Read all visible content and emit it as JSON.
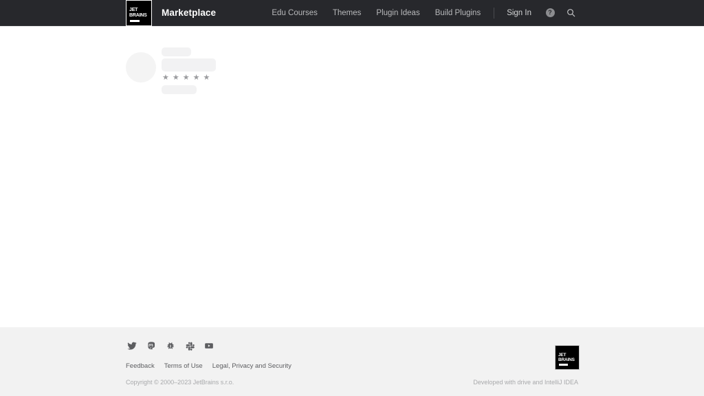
{
  "header": {
    "logo": {
      "line1": "JET",
      "line2": "BRAINS",
      "alt": "JetBrains"
    },
    "title": "Marketplace",
    "nav_items": [
      {
        "label": "Edu Courses"
      },
      {
        "label": "Themes"
      },
      {
        "label": "Plugin Ideas"
      },
      {
        "label": "Build Plugins"
      }
    ],
    "sign_in": "Sign In",
    "help_glyph": "?",
    "icons": {
      "help": "help-circle-icon",
      "search": "search-icon"
    },
    "colors": {
      "background": "#27282c",
      "text": "#ffffff",
      "nav_text": "#b8b9bb"
    }
  },
  "main": {
    "state": "loading",
    "skeleton": {
      "avatar": "",
      "bar_1": "",
      "bar_2": "",
      "bar_3": "",
      "stars": [
        "★",
        "★",
        "★",
        "★",
        "★"
      ],
      "star_count": 5,
      "placeholder_color": "#f2f2f3",
      "star_color": "#9a9b9e"
    }
  },
  "footer": {
    "social": [
      {
        "name": "twitter-icon",
        "label": "Twitter"
      },
      {
        "name": "mastodon-icon",
        "label": "Mastodon"
      },
      {
        "name": "bug-icon",
        "label": "Issue Tracker"
      },
      {
        "name": "slack-icon",
        "label": "Slack"
      },
      {
        "name": "youtube-icon",
        "label": "YouTube"
      }
    ],
    "links": [
      {
        "label": "Feedback"
      },
      {
        "label": "Terms of Use"
      },
      {
        "label": "Legal, Privacy and Security"
      }
    ],
    "copyright": "Copyright © 2000–2023 JetBrains s.r.o.",
    "developed_with": "Developed with drive and IntelliJ IDEA",
    "logo": {
      "line1": "JET",
      "line2": "BRAINS",
      "alt": "JetBrains"
    },
    "colors": {
      "background": "#f2f2f2",
      "link_text": "#5c5d60",
      "muted_text": "#a8a9ab"
    }
  }
}
